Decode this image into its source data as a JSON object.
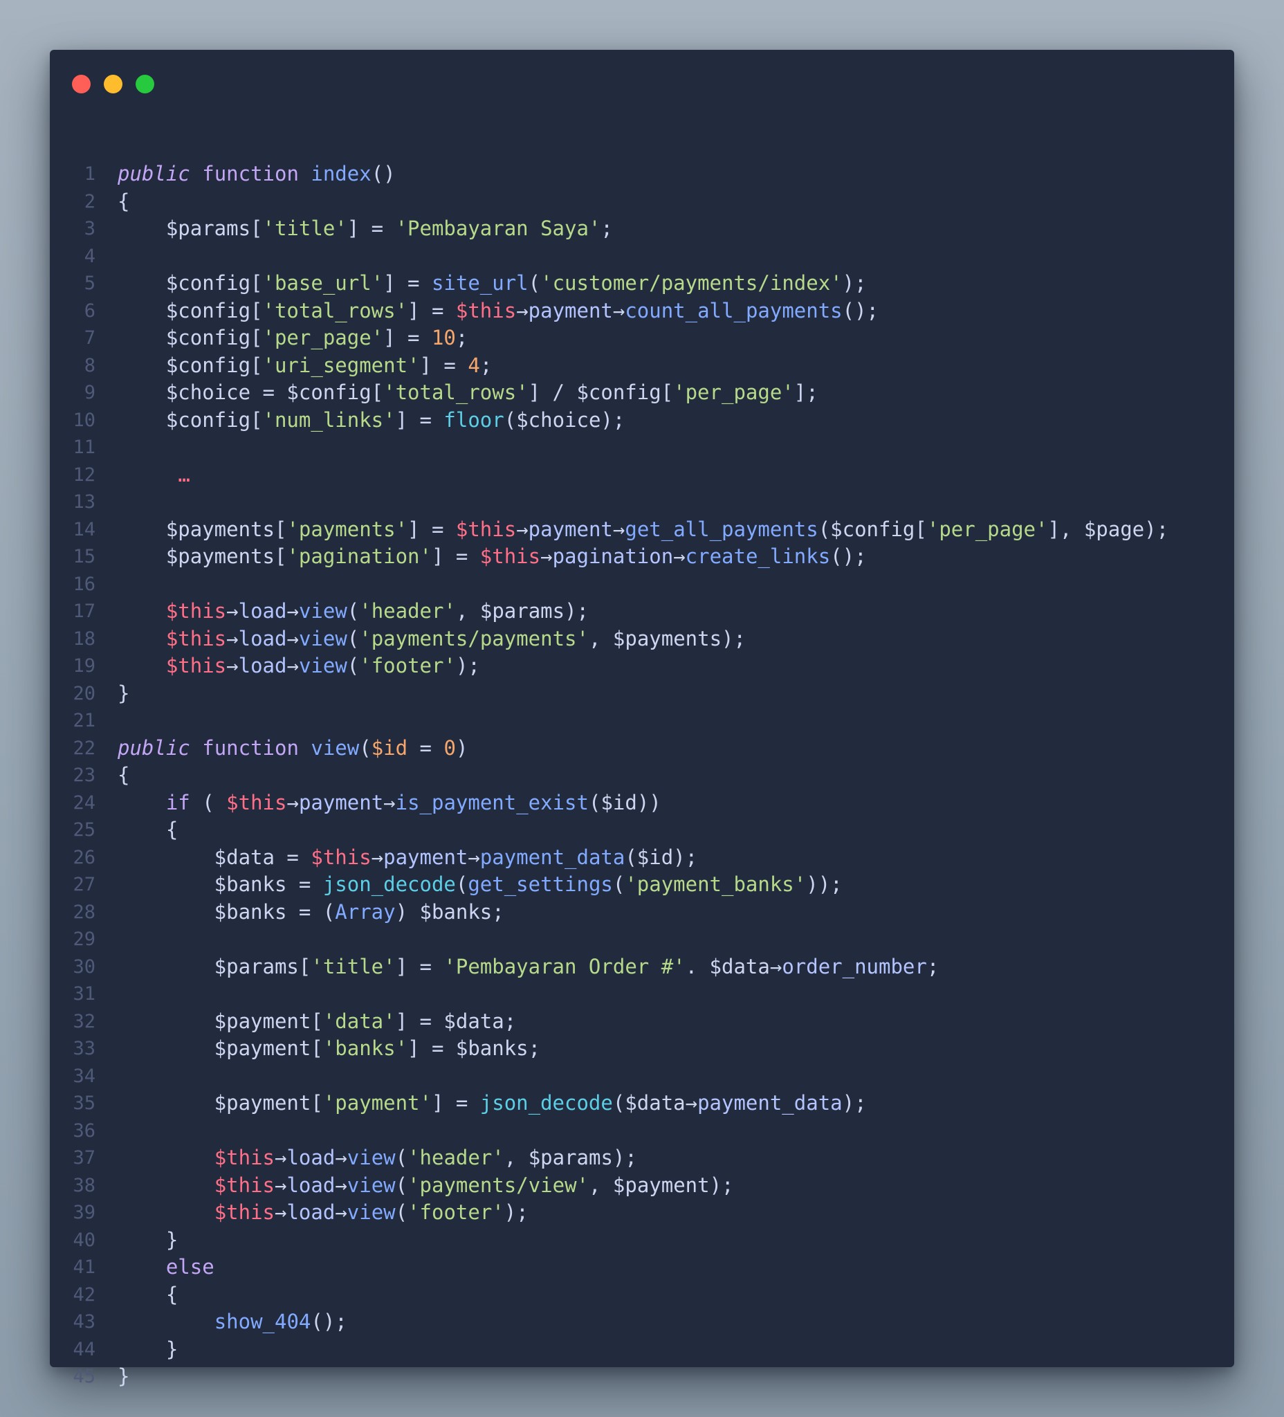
{
  "window": {
    "controls": [
      "close",
      "minimize",
      "maximize"
    ],
    "colors": {
      "close": "#ff5f56",
      "minimize": "#ffbd2e",
      "maximize": "#27c93f",
      "background": "#222a3d"
    }
  },
  "code_lines": [
    [
      [
        "kw",
        "public"
      ],
      [
        "pl",
        " "
      ],
      [
        "fn",
        "function"
      ],
      [
        "pl",
        " "
      ],
      [
        "nm",
        "index"
      ],
      [
        "pl",
        "()"
      ]
    ],
    [
      [
        "pl",
        "{"
      ]
    ],
    [
      [
        "pl",
        "    $params["
      ],
      [
        "st",
        "'title'"
      ],
      [
        "pl",
        "] = "
      ],
      [
        "st",
        "'Pembayaran Saya'"
      ],
      [
        "pl",
        ";"
      ]
    ],
    [],
    [
      [
        "pl",
        "    $config["
      ],
      [
        "st",
        "'base_url'"
      ],
      [
        "pl",
        "] = "
      ],
      [
        "me",
        "site_url"
      ],
      [
        "pl",
        "("
      ],
      [
        "st",
        "'customer/payments/index'"
      ],
      [
        "pl",
        ");"
      ]
    ],
    [
      [
        "pl",
        "    $config["
      ],
      [
        "st",
        "'total_rows'"
      ],
      [
        "pl",
        "] = "
      ],
      [
        "th",
        "$this"
      ],
      [
        "ar",
        "→"
      ],
      [
        "pr",
        "payment"
      ],
      [
        "ar",
        "→"
      ],
      [
        "me",
        "count_all_payments"
      ],
      [
        "pl",
        "();"
      ]
    ],
    [
      [
        "pl",
        "    $config["
      ],
      [
        "st",
        "'per_page'"
      ],
      [
        "pl",
        "] = "
      ],
      [
        "nu",
        "10"
      ],
      [
        "pl",
        ";"
      ]
    ],
    [
      [
        "pl",
        "    $config["
      ],
      [
        "st",
        "'uri_segment'"
      ],
      [
        "pl",
        "] = "
      ],
      [
        "nu",
        "4"
      ],
      [
        "pl",
        ";"
      ]
    ],
    [
      [
        "pl",
        "    $choice = $config["
      ],
      [
        "st",
        "'total_rows'"
      ],
      [
        "pl",
        "] / $config["
      ],
      [
        "st",
        "'per_page'"
      ],
      [
        "pl",
        "];"
      ]
    ],
    [
      [
        "pl",
        "    $config["
      ],
      [
        "st",
        "'num_links'"
      ],
      [
        "pl",
        "] = "
      ],
      [
        "bi",
        "floor"
      ],
      [
        "pl",
        "($choice);"
      ]
    ],
    [],
    [
      [
        "pl",
        "     "
      ],
      [
        "el",
        "…"
      ]
    ],
    [],
    [
      [
        "pl",
        "    $payments["
      ],
      [
        "st",
        "'payments'"
      ],
      [
        "pl",
        "] = "
      ],
      [
        "th",
        "$this"
      ],
      [
        "ar",
        "→"
      ],
      [
        "pr",
        "payment"
      ],
      [
        "ar",
        "→"
      ],
      [
        "me",
        "get_all_payments"
      ],
      [
        "pl",
        "($config["
      ],
      [
        "st",
        "'per_page'"
      ],
      [
        "pl",
        "], $page);"
      ]
    ],
    [
      [
        "pl",
        "    $payments["
      ],
      [
        "st",
        "'pagination'"
      ],
      [
        "pl",
        "] = "
      ],
      [
        "th",
        "$this"
      ],
      [
        "ar",
        "→"
      ],
      [
        "pr",
        "pagination"
      ],
      [
        "ar",
        "→"
      ],
      [
        "me",
        "create_links"
      ],
      [
        "pl",
        "();"
      ]
    ],
    [],
    [
      [
        "pl",
        "    "
      ],
      [
        "th",
        "$this"
      ],
      [
        "ar",
        "→"
      ],
      [
        "pr",
        "load"
      ],
      [
        "ar",
        "→"
      ],
      [
        "me",
        "view"
      ],
      [
        "pl",
        "("
      ],
      [
        "st",
        "'header'"
      ],
      [
        "pl",
        ", $params);"
      ]
    ],
    [
      [
        "pl",
        "    "
      ],
      [
        "th",
        "$this"
      ],
      [
        "ar",
        "→"
      ],
      [
        "pr",
        "load"
      ],
      [
        "ar",
        "→"
      ],
      [
        "me",
        "view"
      ],
      [
        "pl",
        "("
      ],
      [
        "st",
        "'payments/payments'"
      ],
      [
        "pl",
        ", $payments);"
      ]
    ],
    [
      [
        "pl",
        "    "
      ],
      [
        "th",
        "$this"
      ],
      [
        "ar",
        "→"
      ],
      [
        "pr",
        "load"
      ],
      [
        "ar",
        "→"
      ],
      [
        "me",
        "view"
      ],
      [
        "pl",
        "("
      ],
      [
        "st",
        "'footer'"
      ],
      [
        "pl",
        ");"
      ]
    ],
    [
      [
        "pl",
        "}"
      ]
    ],
    [],
    [
      [
        "kw",
        "public"
      ],
      [
        "pl",
        " "
      ],
      [
        "fn",
        "function"
      ],
      [
        "pl",
        " "
      ],
      [
        "nm",
        "view"
      ],
      [
        "pl",
        "("
      ],
      [
        "vr",
        "$id"
      ],
      [
        "pl",
        " = "
      ],
      [
        "nu",
        "0"
      ],
      [
        "pl",
        ")"
      ]
    ],
    [
      [
        "pl",
        "{"
      ]
    ],
    [
      [
        "pl",
        "    "
      ],
      [
        "cl",
        "if"
      ],
      [
        "pl",
        " ( "
      ],
      [
        "th",
        "$this"
      ],
      [
        "ar",
        "→"
      ],
      [
        "pr",
        "payment"
      ],
      [
        "ar",
        "→"
      ],
      [
        "me",
        "is_payment_exist"
      ],
      [
        "pl",
        "($id))"
      ]
    ],
    [
      [
        "pl",
        "    {"
      ]
    ],
    [
      [
        "pl",
        "        $data = "
      ],
      [
        "th",
        "$this"
      ],
      [
        "ar",
        "→"
      ],
      [
        "pr",
        "payment"
      ],
      [
        "ar",
        "→"
      ],
      [
        "me",
        "payment_data"
      ],
      [
        "pl",
        "($id);"
      ]
    ],
    [
      [
        "pl",
        "        $banks = "
      ],
      [
        "bi",
        "json_decode"
      ],
      [
        "pl",
        "("
      ],
      [
        "me",
        "get_settings"
      ],
      [
        "pl",
        "("
      ],
      [
        "st",
        "'payment_banks'"
      ],
      [
        "pl",
        "));"
      ]
    ],
    [
      [
        "pl",
        "        $banks = ("
      ],
      [
        "me",
        "Array"
      ],
      [
        "pl",
        ") $banks;"
      ]
    ],
    [],
    [
      [
        "pl",
        "        $params["
      ],
      [
        "st",
        "'title'"
      ],
      [
        "pl",
        "] = "
      ],
      [
        "st",
        "'Pembayaran Order #'"
      ],
      [
        "pl",
        ". $data"
      ],
      [
        "ar",
        "→"
      ],
      [
        "pr",
        "order_number"
      ],
      [
        "pl",
        ";"
      ]
    ],
    [],
    [
      [
        "pl",
        "        $payment["
      ],
      [
        "st",
        "'data'"
      ],
      [
        "pl",
        "] = $data;"
      ]
    ],
    [
      [
        "pl",
        "        $payment["
      ],
      [
        "st",
        "'banks'"
      ],
      [
        "pl",
        "] = $banks;"
      ]
    ],
    [],
    [
      [
        "pl",
        "        $payment["
      ],
      [
        "st",
        "'payment'"
      ],
      [
        "pl",
        "] = "
      ],
      [
        "bi",
        "json_decode"
      ],
      [
        "pl",
        "($data"
      ],
      [
        "ar",
        "→"
      ],
      [
        "pr",
        "payment_data"
      ],
      [
        "pl",
        ");"
      ]
    ],
    [],
    [
      [
        "pl",
        "        "
      ],
      [
        "th",
        "$this"
      ],
      [
        "ar",
        "→"
      ],
      [
        "pr",
        "load"
      ],
      [
        "ar",
        "→"
      ],
      [
        "me",
        "view"
      ],
      [
        "pl",
        "("
      ],
      [
        "st",
        "'header'"
      ],
      [
        "pl",
        ", $params);"
      ]
    ],
    [
      [
        "pl",
        "        "
      ],
      [
        "th",
        "$this"
      ],
      [
        "ar",
        "→"
      ],
      [
        "pr",
        "load"
      ],
      [
        "ar",
        "→"
      ],
      [
        "me",
        "view"
      ],
      [
        "pl",
        "("
      ],
      [
        "st",
        "'payments/view'"
      ],
      [
        "pl",
        ", $payment);"
      ]
    ],
    [
      [
        "pl",
        "        "
      ],
      [
        "th",
        "$this"
      ],
      [
        "ar",
        "→"
      ],
      [
        "pr",
        "load"
      ],
      [
        "ar",
        "→"
      ],
      [
        "me",
        "view"
      ],
      [
        "pl",
        "("
      ],
      [
        "st",
        "'footer'"
      ],
      [
        "pl",
        ");"
      ]
    ],
    [
      [
        "pl",
        "    }"
      ]
    ],
    [
      [
        "pl",
        "    "
      ],
      [
        "cl",
        "else"
      ]
    ],
    [
      [
        "pl",
        "    {"
      ]
    ],
    [
      [
        "pl",
        "        "
      ],
      [
        "me",
        "show_404"
      ],
      [
        "pl",
        "();"
      ]
    ],
    [
      [
        "pl",
        "    }"
      ]
    ],
    [
      [
        "pl",
        "}"
      ]
    ]
  ]
}
